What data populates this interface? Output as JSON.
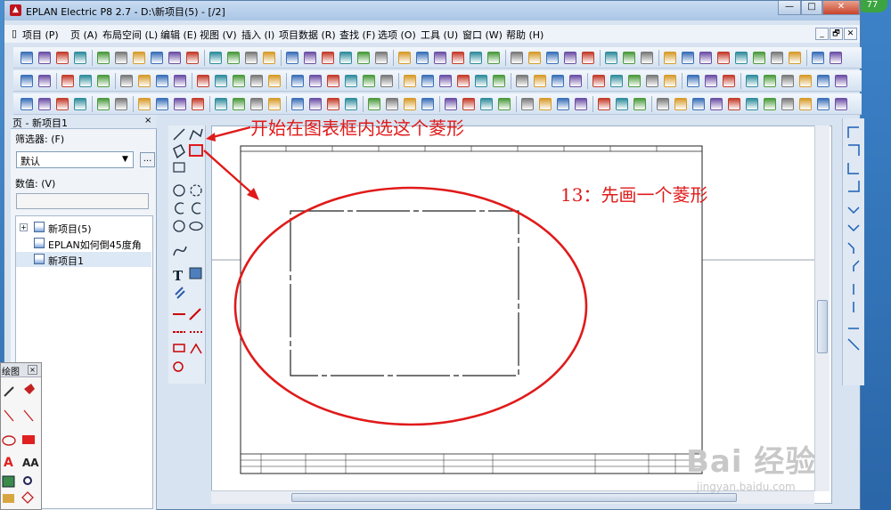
{
  "window": {
    "title": "EPLAN Electric P8 2.7 - D:\\新项目(5) - [/2]",
    "controls": [
      "—",
      "□",
      "✕"
    ],
    "mdi_controls": [
      "_",
      "🗗",
      "✕"
    ]
  },
  "desktop": {
    "badge": "77"
  },
  "menu": [
    "项目 (P)",
    "页 (A)",
    "布局空间 (L)",
    "编辑 (E)",
    "视图 (V)",
    "插入 (I)",
    "项目数据 (R)",
    "查找 (F)",
    "选项 (O)",
    "工具 (U)",
    "窗口 (W)",
    "帮助 (H)"
  ],
  "page_panel": {
    "title": "页 - 新项目1",
    "close": "×",
    "filter_label": "筛选器: (F)",
    "filter_value": "默认",
    "more_button": "...",
    "value_label": "数值: (V)",
    "value_text": "",
    "tree": [
      {
        "label": "新项目(5)",
        "expander": "+"
      },
      {
        "label": "EPLAN如何倒45度角"
      },
      {
        "label": "新项目1"
      }
    ]
  },
  "float_toolbox": {
    "title": "绘图",
    "close": "×"
  },
  "annotations": {
    "select_hint": "开始在图表框内选这个菱形",
    "step_text": "13：先画一个菱形"
  },
  "watermark": {
    "main": "Bai 经验",
    "sub": "jingyan.baidu.com"
  },
  "colors": {
    "annotation": "#e01a1a",
    "accent": "#5b8ed0",
    "title_bar": "#b9d1ec"
  }
}
